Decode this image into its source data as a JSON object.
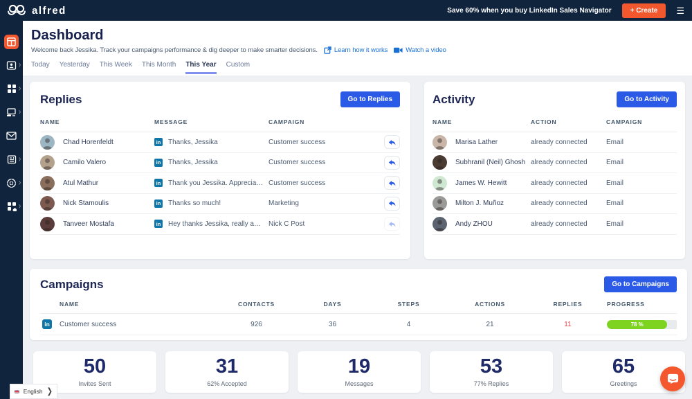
{
  "topbar": {
    "brand": "alfred",
    "promo": "Save 60% when you buy LinkedIn Sales Navigator",
    "create_label": "+ Create"
  },
  "sidebar": {
    "items": [
      "dashboard",
      "contacts",
      "campaigns",
      "devices",
      "inbox",
      "templates",
      "support",
      "integrations"
    ]
  },
  "header": {
    "title": "Dashboard",
    "subtitle": "Welcome back Jessika. Track your campaigns performance & dig deeper to make smarter decisions.",
    "link_learn": "Learn how it works",
    "link_video": "Watch a video",
    "tabs": [
      {
        "label": "Today"
      },
      {
        "label": "Yesterday"
      },
      {
        "label": "This Week"
      },
      {
        "label": "This Month"
      },
      {
        "label": "This Year",
        "active": true
      },
      {
        "label": "Custom"
      }
    ]
  },
  "replies": {
    "title": "Replies",
    "button": "Go to Replies",
    "columns": [
      "NAME",
      "MESSAGE",
      "CAMPAIGN"
    ],
    "rows": [
      {
        "name": "Chad Horenfeldt",
        "message": "Thanks, Jessika",
        "campaign": "Customer success",
        "avatar": "#9db6c4"
      },
      {
        "name": "Camilo Valero",
        "message": "Thanks, Jessika",
        "campaign": "Customer success",
        "avatar": "#b4a18c"
      },
      {
        "name": "Atul Mathur",
        "message": "Thank you Jessika. Appreciate the w...",
        "campaign": "Customer success",
        "avatar": "#8a6f5c"
      },
      {
        "name": "Nick Stamoulis",
        "message": "Thanks so much!",
        "campaign": "Marketing",
        "avatar": "#7d5a4f"
      },
      {
        "name": "Tanveer Mostafa",
        "message": "Hey thanks Jessika, really appreciat...",
        "campaign": "Nick C Post",
        "avatar": "#5a3c3a",
        "muted": true
      }
    ]
  },
  "activity": {
    "title": "Activity",
    "button": "Go to Activity",
    "columns": [
      "NAME",
      "ACTION",
      "CAMPAIGN"
    ],
    "rows": [
      {
        "name": "Marisa Lather",
        "action": "already connected",
        "campaign": "Email",
        "avatar": "#c9b6a8"
      },
      {
        "name": "Subhranil (Neil) Ghosh",
        "action": "already connected",
        "campaign": "Email",
        "avatar": "#4a3b33"
      },
      {
        "name": "James W. Hewitt",
        "action": "already connected",
        "campaign": "Email",
        "avatar": "#cfe8d2"
      },
      {
        "name": "Milton J. Muñoz",
        "action": "already connected",
        "campaign": "Email",
        "avatar": "#9a9a98"
      },
      {
        "name": "Andy ZHOU",
        "action": "already connected",
        "campaign": "Email",
        "avatar": "#5b6470"
      }
    ]
  },
  "campaigns": {
    "title": "Campaigns",
    "button": "Go to Campaigns",
    "columns": [
      "NAME",
      "CONTACTS",
      "DAYS",
      "STEPS",
      "ACTIONS",
      "REPLIES",
      "PROGRESS"
    ],
    "rows": [
      {
        "name": "Customer success",
        "contacts": "926",
        "days": "36",
        "steps": "4",
        "actions": "21",
        "replies": "11",
        "progress_label": "78 %",
        "progress_pct": 78
      }
    ]
  },
  "stats": [
    {
      "value": "50",
      "label": "Invites Sent"
    },
    {
      "value": "31",
      "label": "62% Accepted"
    },
    {
      "value": "19",
      "label": "Messages"
    },
    {
      "value": "53",
      "label": "77% Replies"
    },
    {
      "value": "65",
      "label": "Greetings"
    }
  ],
  "language": {
    "label": "English"
  },
  "colors": {
    "navy": "#10243e",
    "orange": "#f2572e",
    "accent_blue": "#2b5be6",
    "progress_green": "#7ed321",
    "replies_red": "#e8434e"
  }
}
